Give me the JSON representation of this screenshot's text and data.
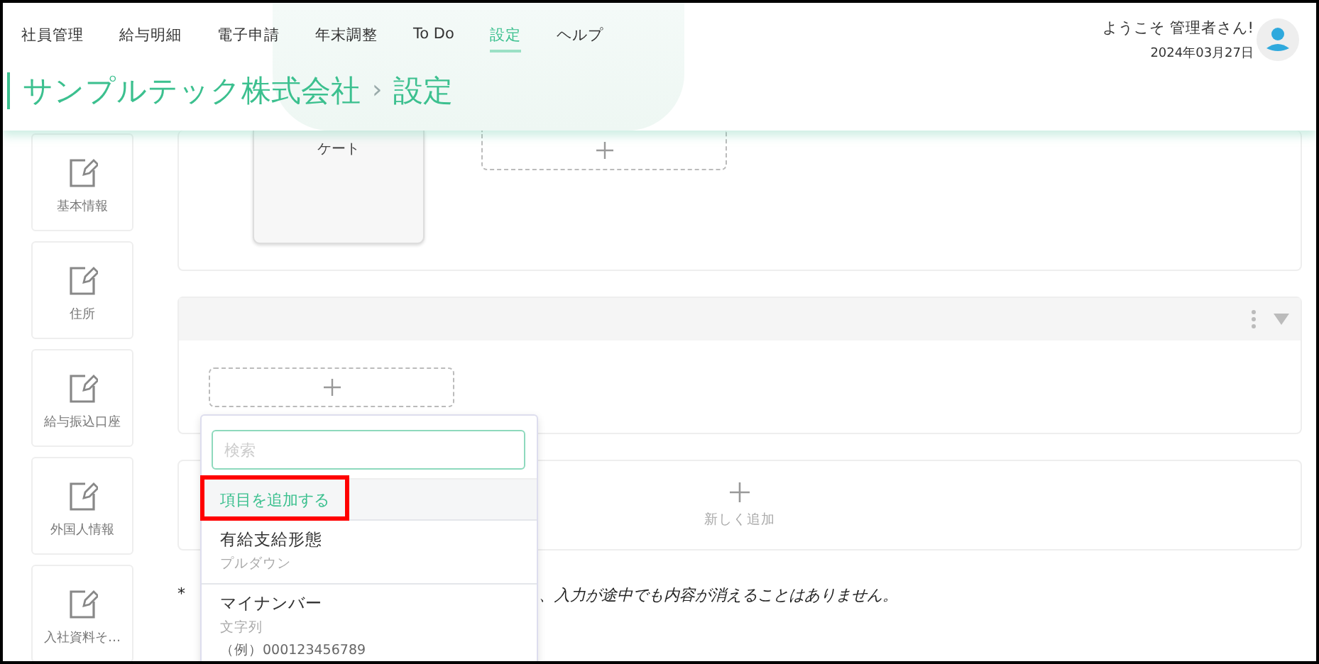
{
  "header": {
    "nav": [
      {
        "label": "社員管理",
        "selected": false
      },
      {
        "label": "給与明細",
        "selected": false
      },
      {
        "label": "電子申請",
        "selected": false
      },
      {
        "label": "年末調整",
        "selected": false
      },
      {
        "label": "To Do",
        "selected": false
      },
      {
        "label": "設定",
        "selected": true
      },
      {
        "label": "ヘルプ",
        "selected": false
      }
    ],
    "welcome": "ようこそ 管理者さん!",
    "date": "2024年03月27日",
    "breadcrumb": {
      "company": "サンプルテック株式会社",
      "separator": "›",
      "page": "設定"
    }
  },
  "sidebar": {
    "items": [
      {
        "label": "基本情報"
      },
      {
        "label": "住所"
      },
      {
        "label": "給与振込口座"
      },
      {
        "label": "外国人情報"
      },
      {
        "label": "入社資料そ…"
      }
    ]
  },
  "sections": [
    {
      "kind": "tiles",
      "tiles": [
        {
          "label": "ケート"
        }
      ]
    },
    {
      "kind": "group"
    },
    {
      "kind": "new",
      "label": "新しく追加"
    }
  ],
  "note": {
    "start": "*",
    "end": "、入力が途中でも内容が消えることはありません。"
  },
  "dropdown": {
    "search": {
      "placeholder": "検索"
    },
    "add_item": {
      "label": "項目を追加する",
      "highlighted": true
    },
    "items": [
      {
        "name": "有給支給形態",
        "type": "プルダウン"
      },
      {
        "name": "マイナンバー",
        "type": "文字列",
        "example": "（例）000123456789"
      }
    ]
  }
}
